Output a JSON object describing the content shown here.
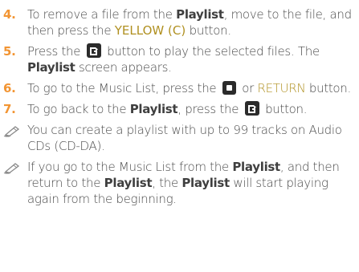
{
  "steps": [
    {
      "num": "4.",
      "parts": {
        "p1": "To remove a file from the ",
        "b1": "Playlist",
        "p2": ", move to the file, and then press the ",
        "y1": "YELLOW (C)",
        "p3": " button."
      }
    },
    {
      "num": "5.",
      "parts": {
        "p1": "Press the ",
        "p2": " button to play the selected files. The ",
        "b1": "Playlist",
        "p3": " screen appears."
      }
    },
    {
      "num": "6.",
      "parts": {
        "p1": "To go to the Music List, press the ",
        "p2": " or ",
        "r1": "RETURN",
        "p3": " button."
      }
    },
    {
      "num": "7.",
      "parts": {
        "p1": "To go back to the ",
        "b1": "Playlist",
        "p2": ", press the ",
        "p3": " button."
      }
    }
  ],
  "notes": [
    {
      "text": "You can create a playlist with up to 99 tracks on Audio CDs (CD-DA)."
    },
    {
      "parts": {
        "p1": "If you go to the Music List from the ",
        "b1": "Playlist",
        "p2": ", and then return to the ",
        "b2": "Playlist",
        "p3": ", the ",
        "b3": "Playlist",
        "p4": " will start playing again from the beginning."
      }
    }
  ],
  "colors": {
    "step_number": "#f29533",
    "highlight": "#b09020",
    "body_text": "#4a4a4a"
  },
  "icons": {
    "play_list_button": "play-list-button-icon",
    "stop_button": "stop-button-icon",
    "note": "pencil-note-icon"
  }
}
